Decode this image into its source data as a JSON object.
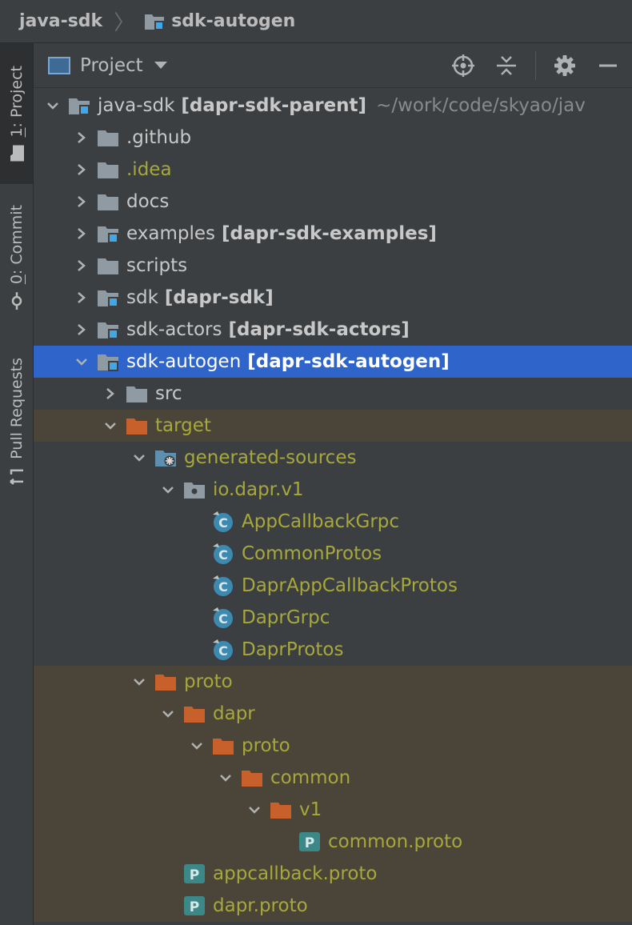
{
  "breadcrumb": {
    "root": "java-sdk",
    "separator": "〉",
    "current": "sdk-autogen"
  },
  "strip": {
    "tabs": [
      {
        "label_prefix": "1",
        "label": ": Project",
        "icon": "folder-icon"
      },
      {
        "label_prefix": "0",
        "label": ": Commit",
        "icon": "commit-icon"
      },
      {
        "label_prefix": "",
        "label": "Pull Requests",
        "icon": "pull-request-icon"
      }
    ]
  },
  "panel": {
    "title": "Project"
  },
  "tree": {
    "rows": [
      {
        "name": "java-sdk",
        "module": "[dapr-sdk-parent]",
        "path": "~/work/code/skyao/jav"
      },
      {
        "name": ".github"
      },
      {
        "name": ".idea"
      },
      {
        "name": "docs"
      },
      {
        "name": "examples",
        "module": "[dapr-sdk-examples]"
      },
      {
        "name": "scripts"
      },
      {
        "name": "sdk",
        "module": "[dapr-sdk]"
      },
      {
        "name": "sdk-actors",
        "module": "[dapr-sdk-actors]"
      },
      {
        "name": "sdk-autogen",
        "module": "[dapr-sdk-autogen]"
      },
      {
        "name": "src"
      },
      {
        "name": "target"
      },
      {
        "name": "generated-sources"
      },
      {
        "name": "io.dapr.v1"
      },
      {
        "name": "AppCallbackGrpc"
      },
      {
        "name": "CommonProtos"
      },
      {
        "name": "DaprAppCallbackProtos"
      },
      {
        "name": "DaprGrpc"
      },
      {
        "name": "DaprProtos"
      },
      {
        "name": "proto"
      },
      {
        "name": "dapr"
      },
      {
        "name": "proto"
      },
      {
        "name": "common"
      },
      {
        "name": "v1"
      },
      {
        "name": "common.proto"
      },
      {
        "name": "appcallback.proto"
      },
      {
        "name": "dapr.proto"
      }
    ]
  },
  "colors": {
    "background": "#3c3f41",
    "selection": "#2f65ca",
    "excluded_shade": "#4a4538",
    "ignored_text": "#a8a83a",
    "excluded_folder": "#c8602c",
    "folder": "#8f9aa3",
    "module_badge": "#40a8e8",
    "class_icon": "#3d8ab0",
    "proto_icon": "#3c8787"
  }
}
